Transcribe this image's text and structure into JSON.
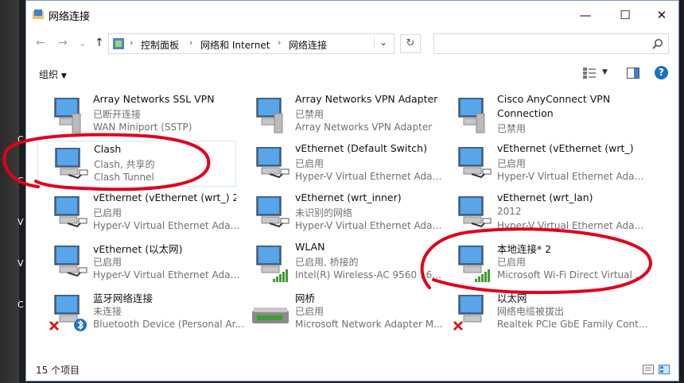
{
  "window": {
    "title": "网络连接"
  },
  "captions": {
    "minimize": "—",
    "maximize": "☐",
    "close": "✕"
  },
  "nav": {
    "back": "←",
    "forward": "→",
    "dropdown": "⌄",
    "up": "↑",
    "refresh": "↻"
  },
  "breadcrumb": [
    "控制面板",
    "网络和 Internet",
    "网络连接"
  ],
  "breadcrumb_sep": "›",
  "toolbar": {
    "organize_label": "组织",
    "help_label": "?"
  },
  "status": {
    "count_text": "15 个项目"
  },
  "desktop": {
    "side_glyphs": [
      "C",
      "C",
      "V",
      "V",
      "C"
    ]
  },
  "connections": [
    {
      "name": "Array Networks SSL VPN",
      "line2": "已断开连接",
      "line3": "WAN Miniport (SSTP)",
      "icon": "vpn-adapter-icon",
      "status_overlay": "none"
    },
    {
      "name": "Array Networks VPN Adapter",
      "line2": "已禁用",
      "line3": "Array Networks VPN Adapter",
      "icon": "vpn-adapter-icon",
      "status_overlay": "none"
    },
    {
      "name": "Cisco AnyConnect VPN",
      "name2": "Connection",
      "line2": "已禁用",
      "line3": "",
      "icon": "vpn-adapter-icon",
      "status_overlay": "none"
    },
    {
      "name": "Clash",
      "line2": "Clash, 共享的",
      "line3": "Clash Tunnel",
      "icon": "network-adapter-icon",
      "status_overlay": "cable"
    },
    {
      "name": "vEthernet (Default Switch)",
      "line2": "已启用",
      "line3": "Hyper-V Virtual Ethernet Adap...",
      "icon": "network-adapter-icon",
      "status_overlay": "cable"
    },
    {
      "name": "vEthernet (vEthernet (wrt_)",
      "line2": "已启用",
      "line3": "Hyper-V Virtual Ethernet Adap...",
      "icon": "network-adapter-icon",
      "status_overlay": "cable"
    },
    {
      "name": "vEthernet (vEthernet (wrt_) 2",
      "line2": "已启用",
      "line3": "Hyper-V Virtual Ethernet Adap...",
      "icon": "network-adapter-icon",
      "status_overlay": "cable"
    },
    {
      "name": "vEthernet (wrt_inner)",
      "line2": "未识别的网络",
      "line3": "Hyper-V Virtual Ethernet Adap...",
      "icon": "network-adapter-icon",
      "status_overlay": "cable"
    },
    {
      "name": "vEthernet (wrt_lan)",
      "line2": "2012",
      "line3": "Hyper-V Virtual Ethernet Adap...",
      "icon": "network-adapter-icon",
      "status_overlay": "cable"
    },
    {
      "name": "vEthernet (以太网)",
      "line2": "已启用",
      "line3": "Hyper-V Virtual Ethernet Adap...",
      "icon": "network-adapter-icon",
      "status_overlay": "cable"
    },
    {
      "name": "WLAN",
      "line2": "已启用, 桥接的",
      "line3": "Intel(R) Wireless-AC 9560 160...",
      "icon": "network-adapter-icon",
      "status_overlay": "signal"
    },
    {
      "name": "本地连接* 2",
      "line2": "已启用",
      "line3": "Microsoft Wi-Fi Direct Virtual ...",
      "icon": "network-adapter-icon",
      "status_overlay": "signal"
    },
    {
      "name": "蓝牙网络连接",
      "line2": "未连接",
      "line3": "Bluetooth Device (Personal Ar...",
      "icon": "network-adapter-icon",
      "status_overlay": "bluetooth"
    },
    {
      "name": "网桥",
      "line2": "已启用",
      "line3": "Microsoft Network Adapter M...",
      "icon": "network-bridge-icon",
      "status_overlay": "none"
    },
    {
      "name": "以太网",
      "line2": "网络电缆被拔出",
      "line3": "Realtek PCIe GbE Family Contr...",
      "icon": "network-adapter-icon",
      "status_overlay": "error"
    }
  ],
  "colors": {
    "accent": "#0078d7",
    "annotation": "#e0001b",
    "selection_border": "#cce8ff"
  }
}
